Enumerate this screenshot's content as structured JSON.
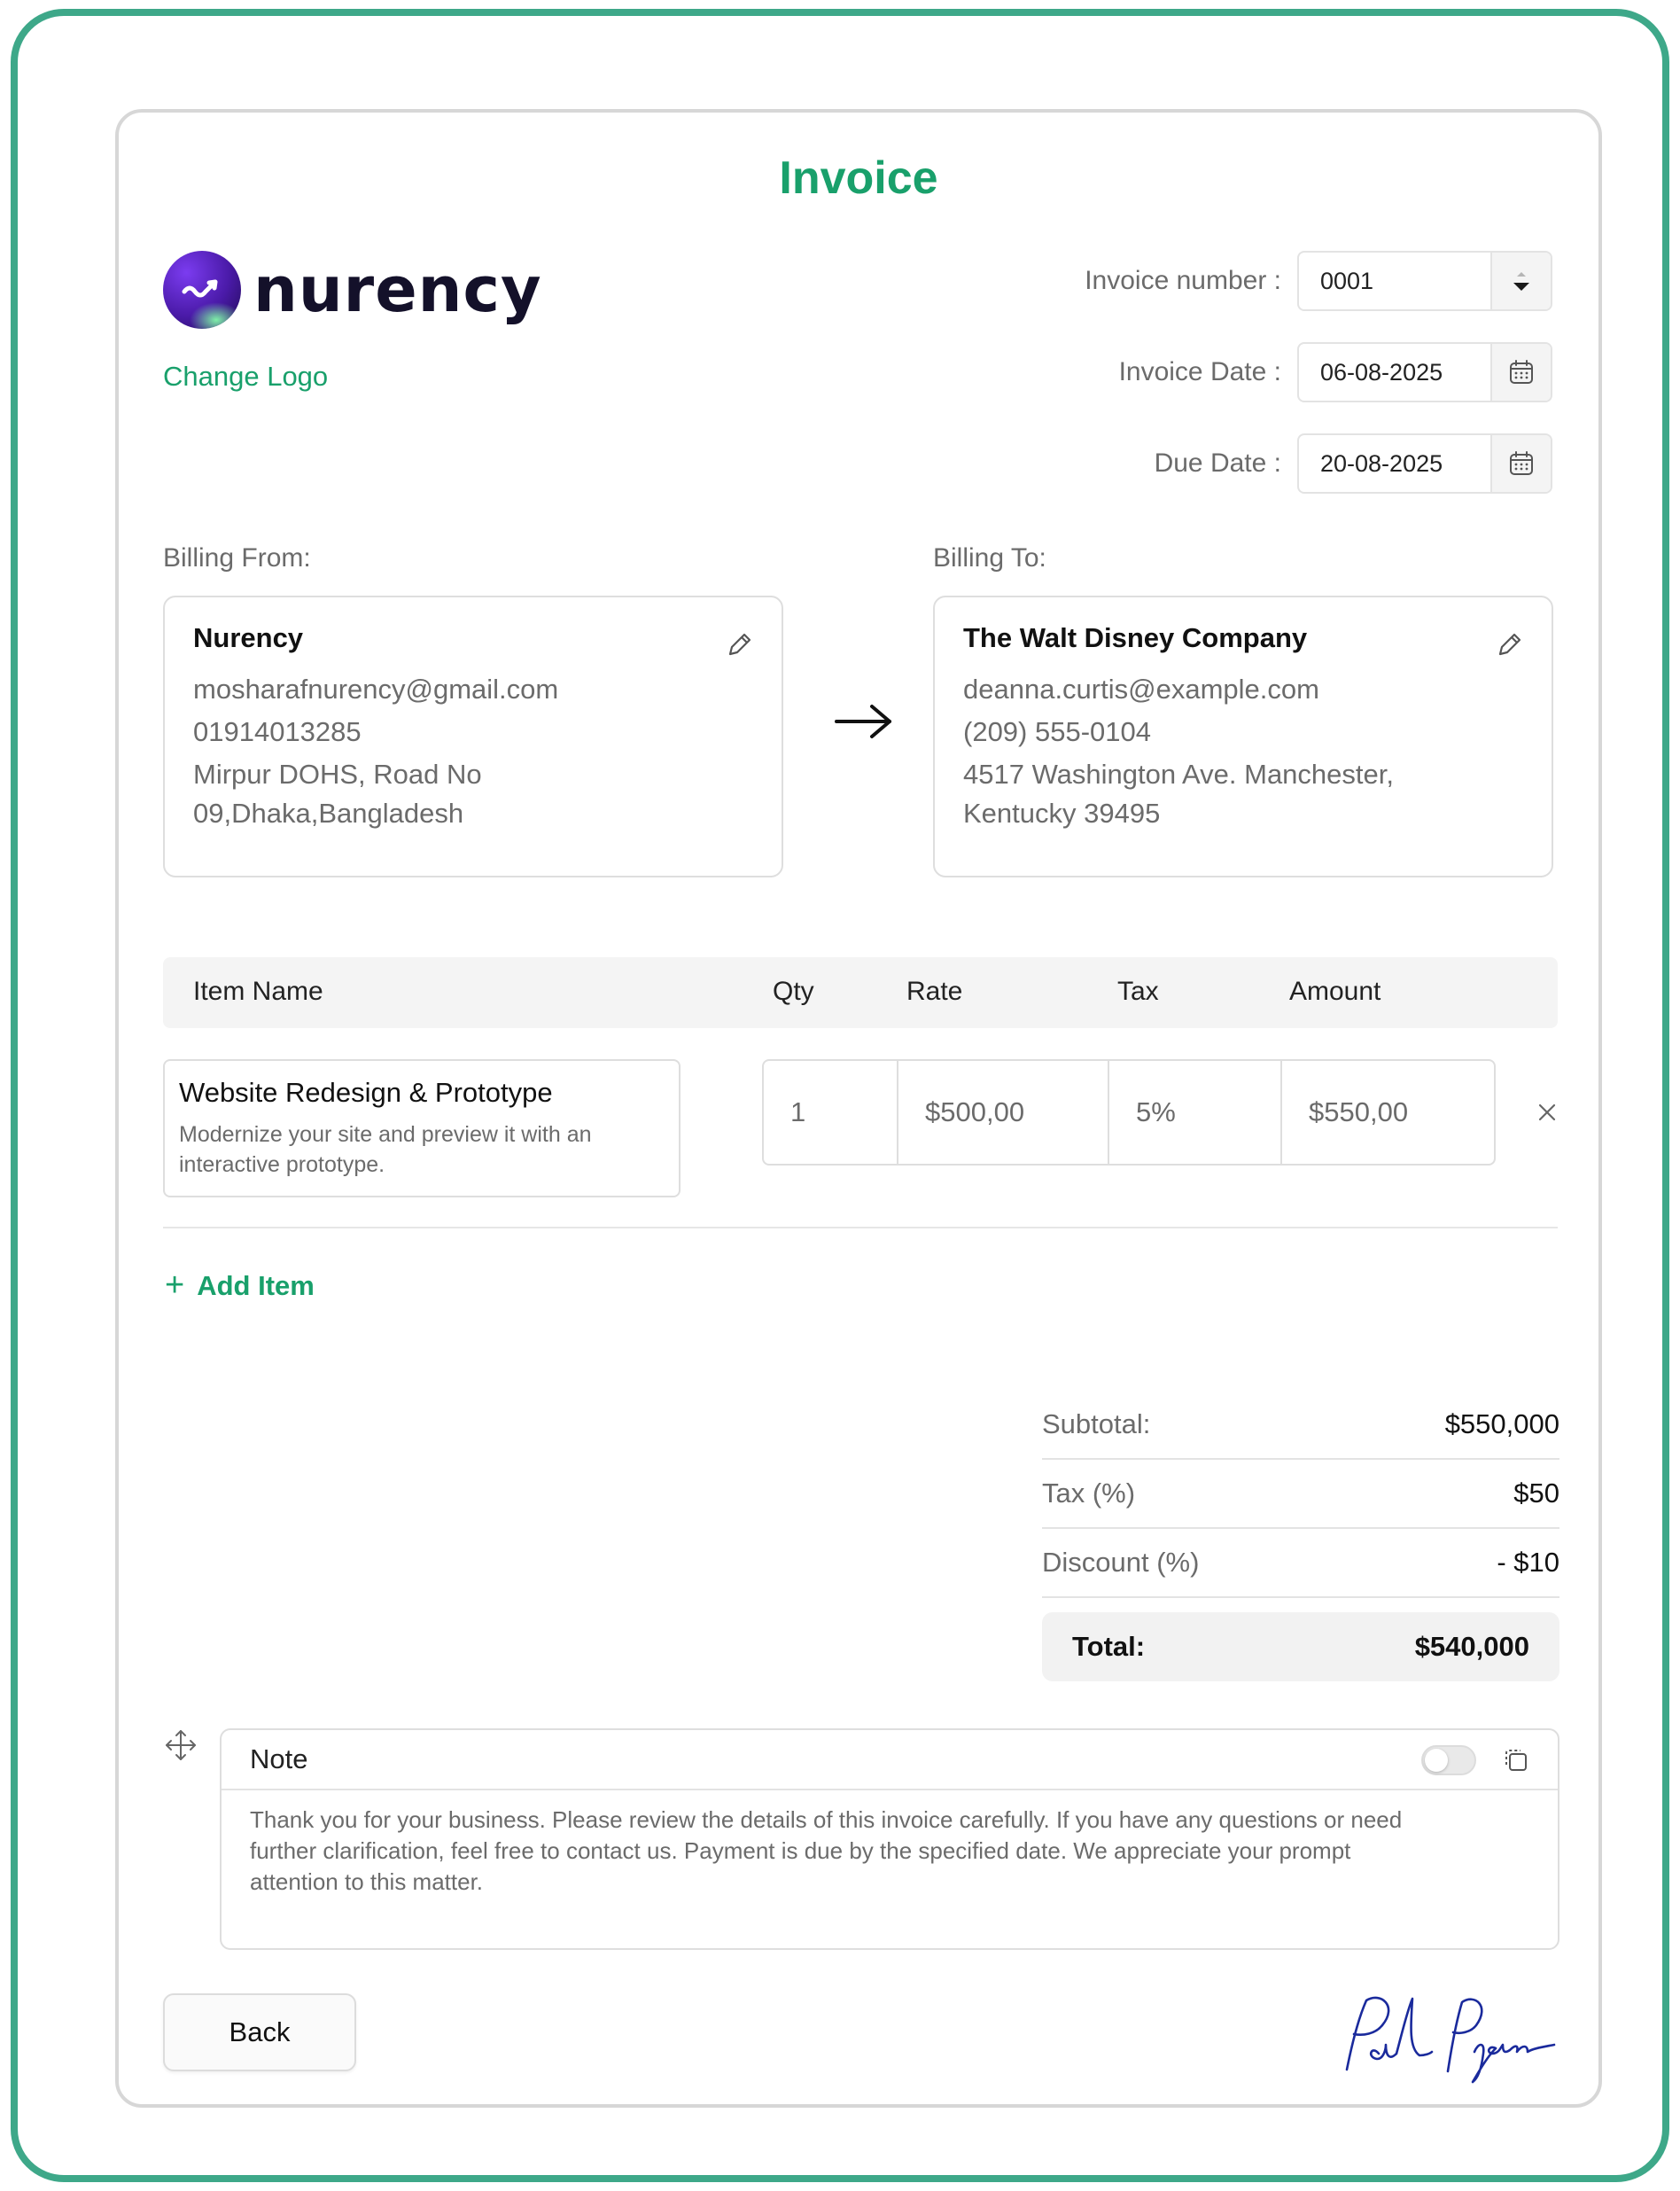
{
  "header": {
    "title": "Invoice"
  },
  "logo": {
    "brand_text": "nurency",
    "change_logo_label": "Change Logo"
  },
  "meta": {
    "invoice_number_label": "Invoice number :",
    "invoice_number_value": "0001",
    "invoice_date_label": "Invoice Date :",
    "invoice_date_value": "06-08-2025",
    "due_date_label": "Due Date :",
    "due_date_value": "20-08-2025"
  },
  "billing_from": {
    "label": "Billing From:",
    "name": "Nurency",
    "email": "mosharafnurency@gmail.com",
    "phone": "01914013285",
    "address_line1": "Mirpur DOHS, Road No",
    "address_line2": "09,Dhaka,Bangladesh"
  },
  "billing_to": {
    "label": "Billing To:",
    "name": "The Walt Disney Company",
    "email": "deanna.curtis@example.com",
    "phone": "(209) 555-0104",
    "address_line1": "4517 Washington Ave. Manchester,",
    "address_line2": "Kentucky 39495"
  },
  "table": {
    "headers": {
      "item_name": "Item Name",
      "qty": "Qty",
      "rate": "Rate",
      "tax": "Tax",
      "amount": "Amount"
    },
    "items": [
      {
        "title": "Website Redesign & Prototype",
        "desc_line1": "Modernize your site and preview it with an",
        "desc_line2": "interactive prototype.",
        "qty": "1",
        "rate": "$500,00",
        "tax": "5%",
        "amount": "$550,00"
      }
    ]
  },
  "add_item_label": "Add Item",
  "summary": {
    "subtotal_label": "Subtotal:",
    "subtotal_value": "$550,000",
    "tax_label": "Tax (%)",
    "tax_value": "$50",
    "discount_label": "Discount (%)",
    "discount_value": "- $10",
    "total_label": "Total:",
    "total_value": "$540,000"
  },
  "note": {
    "title": "Note",
    "toggle_on": false,
    "body_line1": "Thank you for your business. Please review the details of this invoice carefully. If you have any questions or need",
    "body_line2": "further clarification, feel free to contact us. Payment is due by the specified date. We appreciate your prompt",
    "body_line3": "attention to this matter."
  },
  "footer": {
    "back_label": "Back"
  },
  "colors": {
    "accent": "#19a06b",
    "frame": "#3ea889",
    "signature": "#1a2a9c"
  }
}
